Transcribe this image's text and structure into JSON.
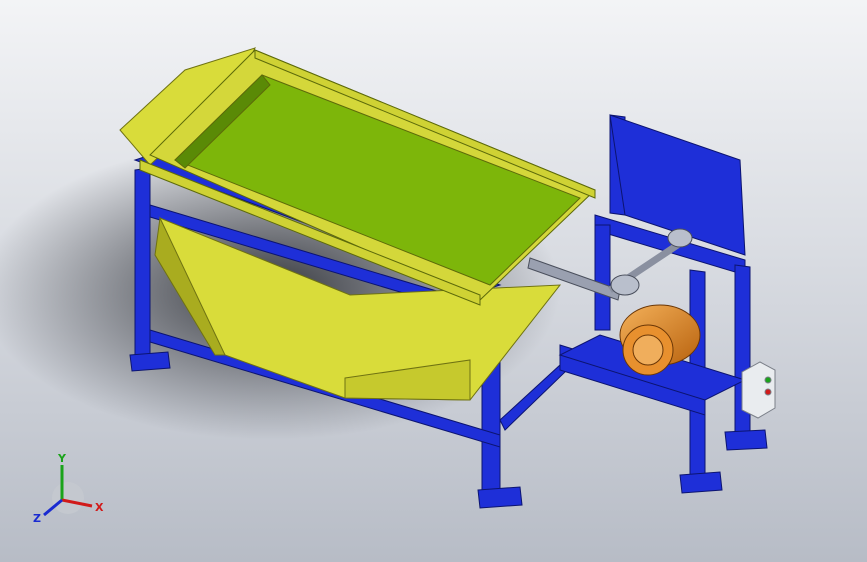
{
  "scene": {
    "colors": {
      "frame": "#1e2fd8",
      "frame_dark": "#12208f",
      "hopper": "#d9dc3a",
      "hopper_dark": "#a9ac1f",
      "screen": "#7db60a",
      "motor": "#e8902e",
      "steel": "#9aa0b0",
      "box": "#e9ecef"
    },
    "triad": {
      "x_label": "X",
      "y_label": "Y",
      "z_label": "Z",
      "x_color": "#d11a1a",
      "y_color": "#1aa31a",
      "z_color": "#1a2bd1"
    }
  }
}
